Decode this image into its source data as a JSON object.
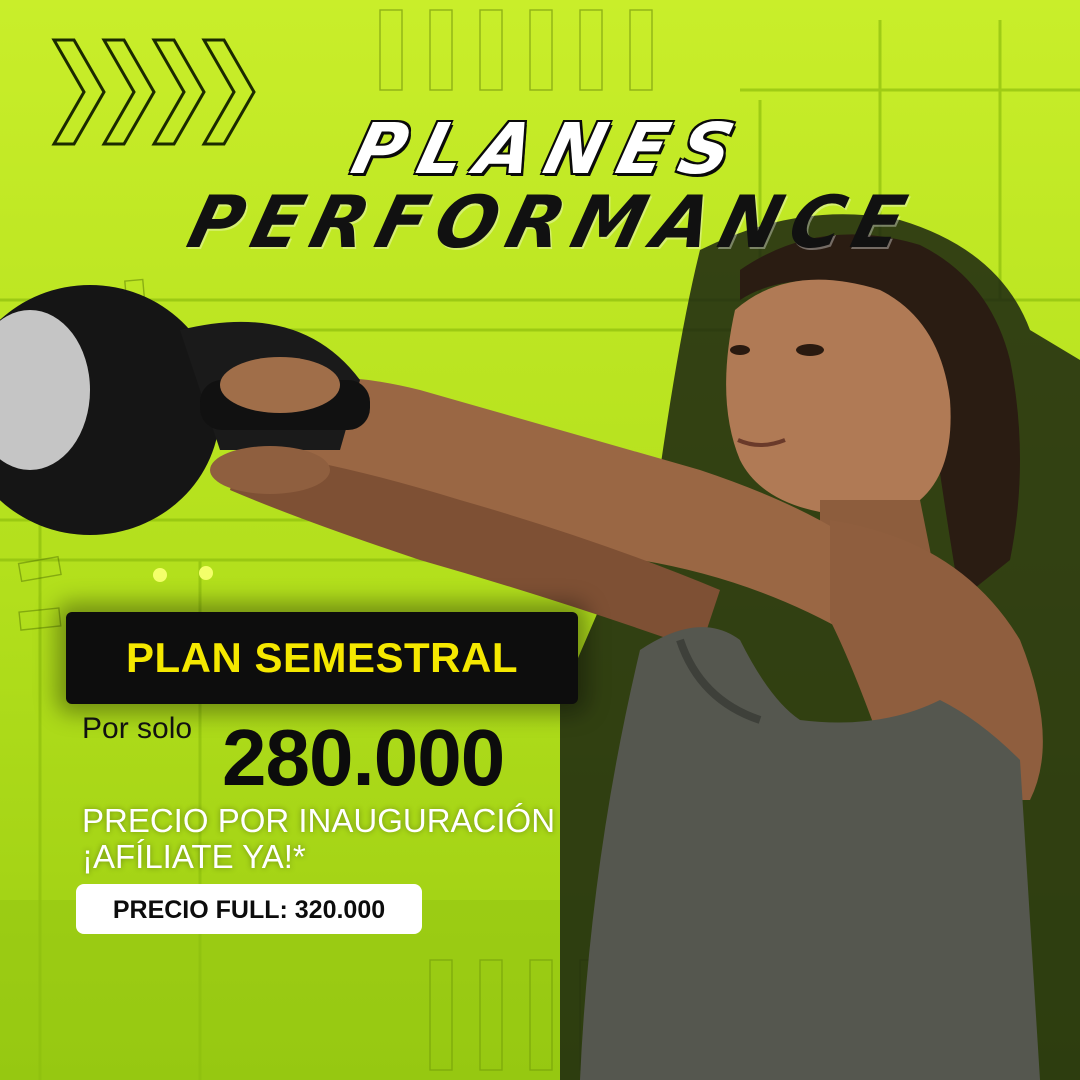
{
  "ad": {
    "title_line1": "PLANES",
    "title_line2": "PERFORMANCE",
    "plan_name": "PLAN SEMESTRAL",
    "price_prefix": "Por solo",
    "price": "280.000",
    "promo_line1": "PRECIO POR INAUGURACIÓN",
    "promo_line2": "¡AFÍLIATE YA!*",
    "full_price_label": "PRECIO FULL: 320.000"
  },
  "decor": {
    "chevrons_icon": "chevron-arrows-icon",
    "photo_subject": "athlete-kettlebell-photo"
  },
  "colors": {
    "background": "#b6e21c",
    "plan_box": "#0d0d0d",
    "plan_text": "#f5e800",
    "price_text": "#0c0c0c",
    "promo_text": "#ffffff",
    "full_price_box": "#ffffff"
  }
}
